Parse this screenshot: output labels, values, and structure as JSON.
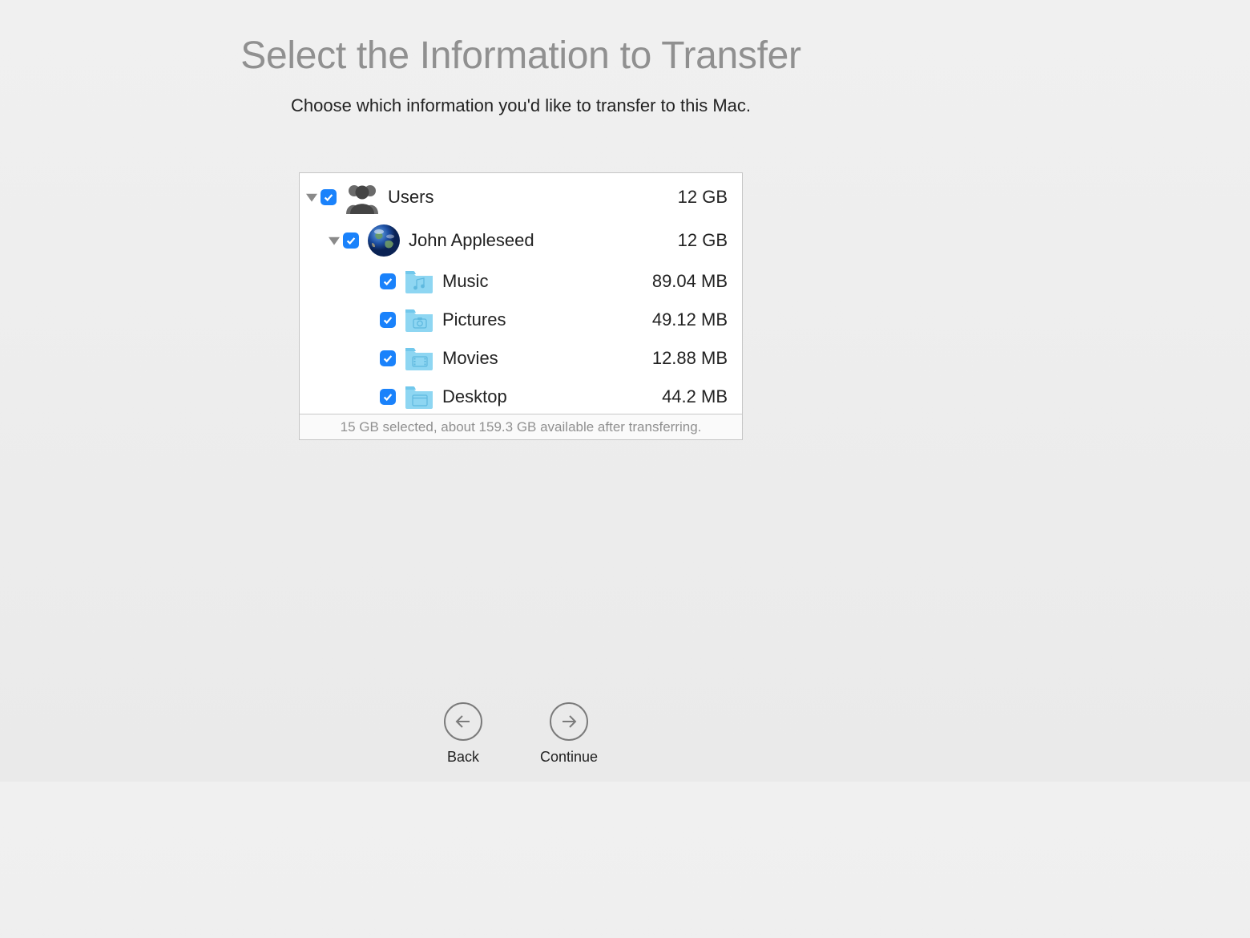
{
  "header": {
    "title": "Select the Information to Transfer",
    "subtitle": "Choose which information you'd like to transfer to this Mac."
  },
  "tree": {
    "root": {
      "name": "Users",
      "size": "12 GB",
      "user": {
        "name": "John Appleseed",
        "size": "12 GB",
        "folders": [
          {
            "name": "Music",
            "size": "89.04 MB",
            "icon": "music-folder-icon"
          },
          {
            "name": "Pictures",
            "size": "49.12 MB",
            "icon": "pictures-folder-icon"
          },
          {
            "name": "Movies",
            "size": "12.88 MB",
            "icon": "movies-folder-icon"
          },
          {
            "name": "Desktop",
            "size": "44.2 MB",
            "icon": "desktop-folder-icon"
          }
        ]
      }
    }
  },
  "status": "15 GB selected, about 159.3 GB available after transferring.",
  "buttons": {
    "back": "Back",
    "continue": "Continue"
  }
}
